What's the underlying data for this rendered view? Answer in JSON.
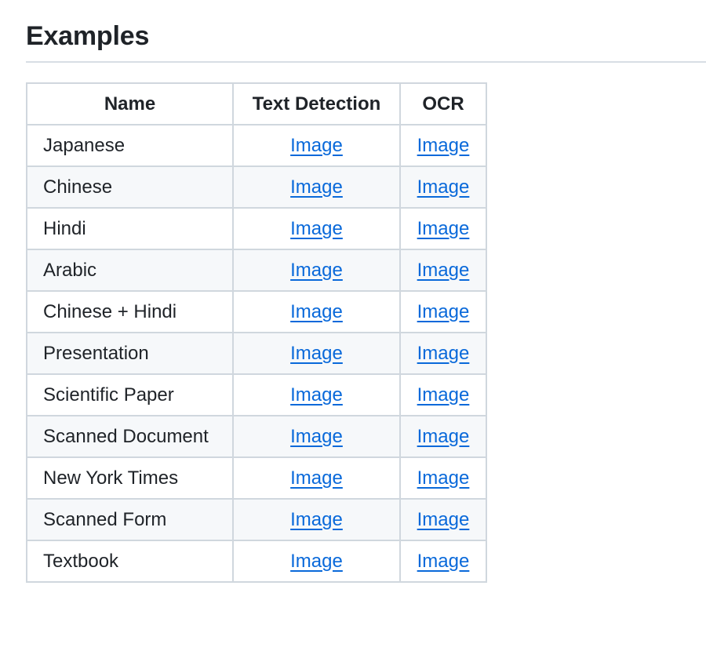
{
  "heading": "Examples",
  "table": {
    "headers": [
      "Name",
      "Text Detection",
      "OCR"
    ],
    "rows": [
      {
        "name": "Japanese",
        "detection": "Image",
        "ocr": "Image"
      },
      {
        "name": "Chinese",
        "detection": "Image",
        "ocr": "Image"
      },
      {
        "name": "Hindi",
        "detection": "Image",
        "ocr": "Image"
      },
      {
        "name": "Arabic",
        "detection": "Image",
        "ocr": "Image"
      },
      {
        "name": "Chinese + Hindi",
        "detection": "Image",
        "ocr": "Image"
      },
      {
        "name": "Presentation",
        "detection": "Image",
        "ocr": "Image"
      },
      {
        "name": "Scientific Paper",
        "detection": "Image",
        "ocr": "Image"
      },
      {
        "name": "Scanned Document",
        "detection": "Image",
        "ocr": "Image"
      },
      {
        "name": "New York Times",
        "detection": "Image",
        "ocr": "Image"
      },
      {
        "name": "Scanned Form",
        "detection": "Image",
        "ocr": "Image"
      },
      {
        "name": "Textbook",
        "detection": "Image",
        "ocr": "Image"
      }
    ]
  },
  "colors": {
    "link": "#0969da",
    "text": "#1f2328",
    "border": "#d0d7de",
    "row_alt": "#f6f8fa"
  }
}
